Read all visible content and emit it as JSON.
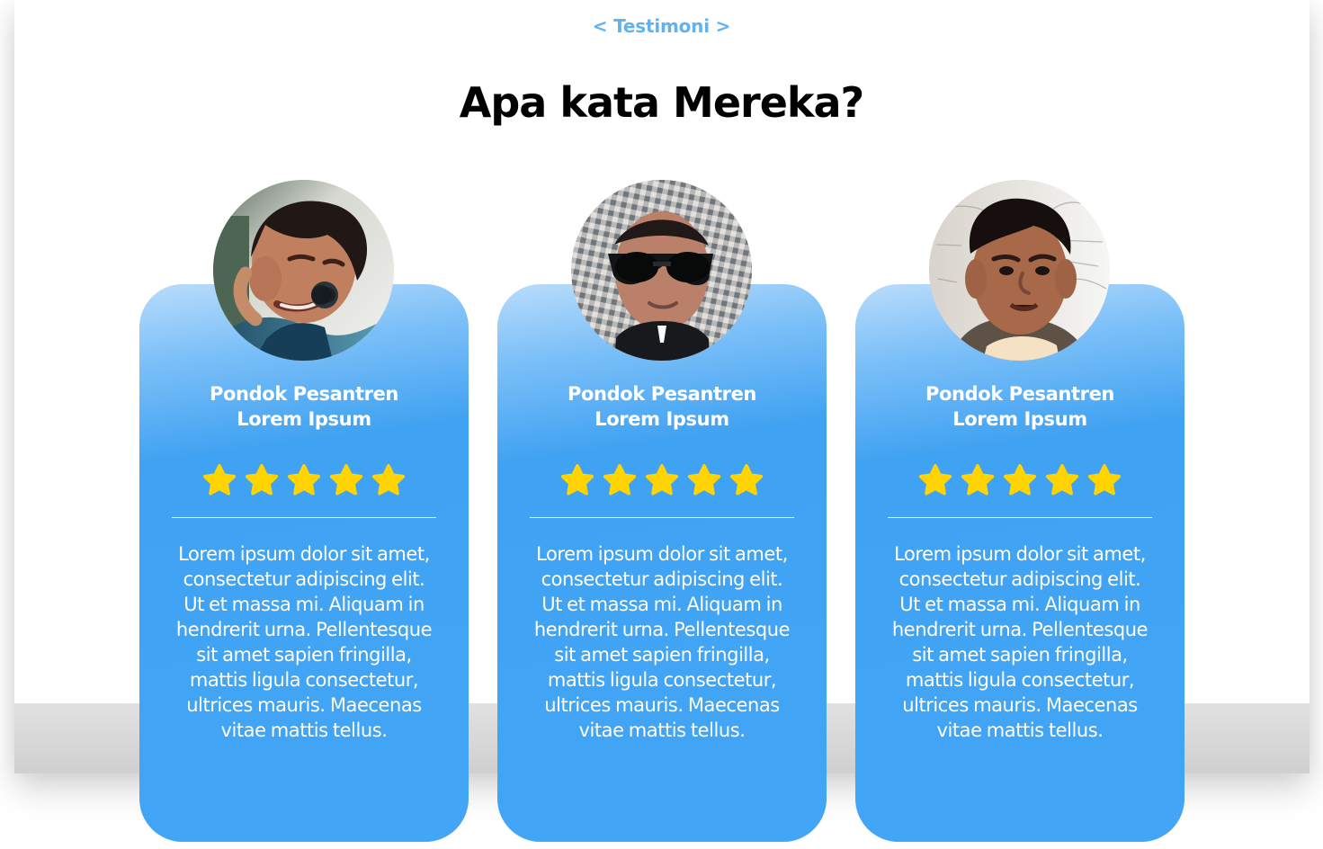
{
  "section": {
    "eyebrow": "< Testimoni >",
    "title": "Apa kata Mereka?"
  },
  "colors": {
    "accent": "#62b2ee",
    "card": "#42a5f5",
    "star": "#ffd400",
    "text_dark": "#000000",
    "text_light": "#ffffff"
  },
  "testimonials": [
    {
      "name_line_1": "Pondok Pesantren",
      "name_line_2": "Lorem Ipsum",
      "rating": 5,
      "quote_lines": [
        "Lorem ipsum dolor sit amet,",
        "consectetur adipiscing elit.",
        "Ut et massa mi. Aliquam in",
        "hendrerit urna. Pellentesque",
        "sit amet sapien fringilla,",
        "mattis ligula consectetur,",
        "ultrices mauris. Maecenas",
        "vitae mattis tellus."
      ]
    },
    {
      "name_line_1": "Pondok Pesantren",
      "name_line_2": "Lorem Ipsum",
      "rating": 5,
      "quote_lines": [
        "Lorem ipsum dolor sit amet,",
        "consectetur adipiscing elit.",
        "Ut et massa mi. Aliquam in",
        "hendrerit urna. Pellentesque",
        "sit amet sapien fringilla,",
        "mattis ligula consectetur,",
        "ultrices mauris. Maecenas",
        "vitae mattis tellus."
      ]
    },
    {
      "name_line_1": "Pondok Pesantren",
      "name_line_2": "Lorem Ipsum",
      "rating": 5,
      "quote_lines": [
        "Lorem ipsum dolor sit amet,",
        "consectetur adipiscing elit.",
        "Ut et massa mi. Aliquam in",
        "hendrerit urna. Pellentesque",
        "sit amet sapien fringilla,",
        "mattis ligula consectetur,",
        "ultrices mauris. Maecenas",
        "vitae mattis tellus."
      ]
    }
  ]
}
